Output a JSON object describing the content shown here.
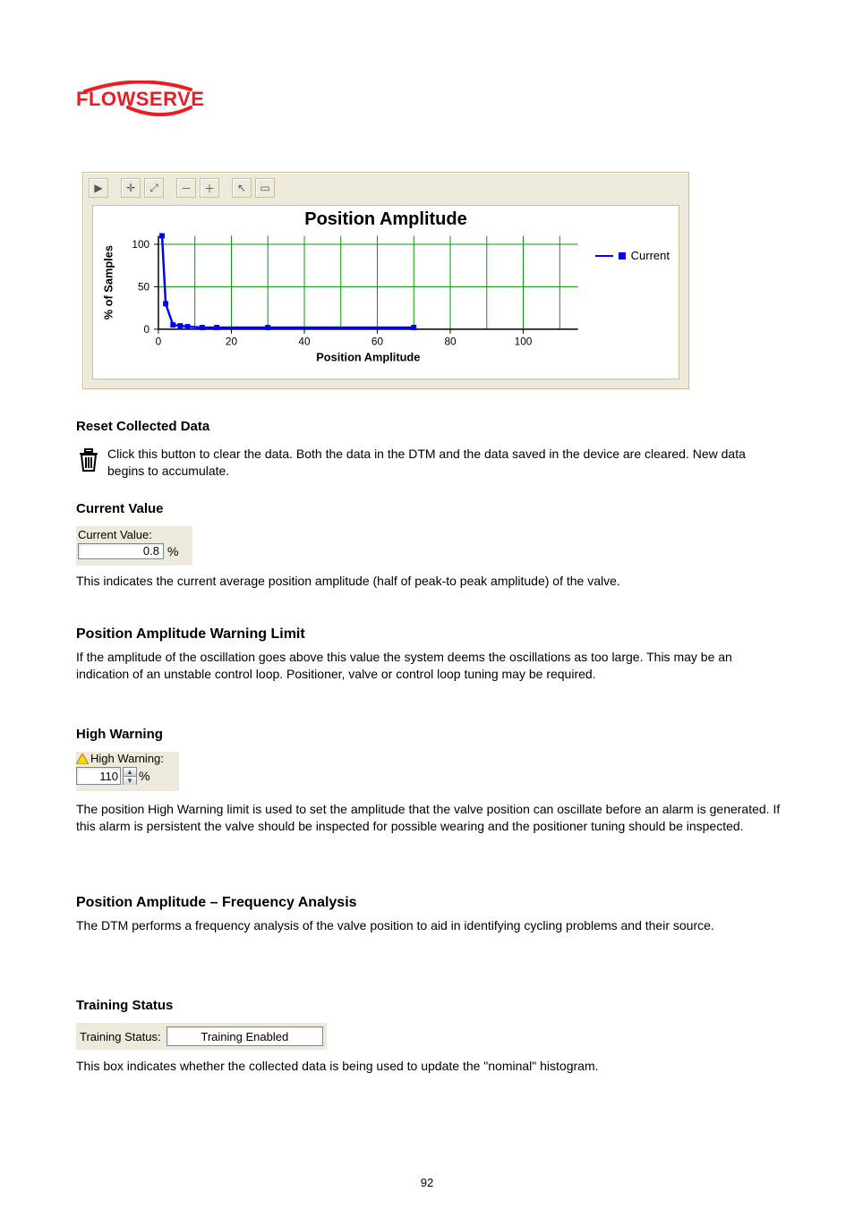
{
  "logo": {
    "text": "FLOWSERVE"
  },
  "chart_data": {
    "type": "line",
    "title": "Position Amplitude",
    "xlabel": "Position Amplitude",
    "ylabel": "% of Samples",
    "xlim": [
      0,
      115
    ],
    "ylim": [
      0,
      110
    ],
    "xticks": [
      0,
      20,
      40,
      60,
      80,
      100
    ],
    "yticks": [
      0,
      50,
      100
    ],
    "series": [
      {
        "name": "Current",
        "x": [
          1,
          2,
          4,
          6,
          8,
          12,
          16,
          30,
          70
        ],
        "values": [
          110,
          30,
          5,
          4,
          3,
          2,
          2,
          2,
          2
        ]
      }
    ]
  },
  "toolbar": {
    "t1": "▶",
    "t2": "✛",
    "t3": "⤢",
    "t4": "－",
    "t5": "＋",
    "t6": "↖",
    "t7": "▭"
  },
  "sections": {
    "reset_title": "Reset Collected Data",
    "reset_body": "Click this button to clear the data. Both the data in the DTM and the data saved in the device are cleared. New data begins to accumulate.",
    "cv_title": "Current Value",
    "cv_body": "This indicates the current average position amplitude (half of peak-to peak amplitude) of the valve.",
    "hw_heading": "Position Amplitude Warning Limit",
    "hw_p1": "If the amplitude of the oscillation goes above this value the system deems the oscillations as too large. This may be an indication of an unstable control loop. Positioner, valve or control loop tuning may be required.",
    "hw_sub": "High Warning",
    "hw_p2": "The position High Warning limit is used to set the amplitude that the valve position can oscillate before an alarm is generated. If this alarm is persistent the valve should be inspected for possible wearing and the positioner tuning should be inspected.",
    "fa_heading": "Position Amplitude – Frequency Analysis",
    "fa_body": "The DTM performs a frequency analysis of the valve position to aid in identifying cycling problems and their source.",
    "ts_title": "Training Status",
    "ts_body": "This box indicates whether the collected data is being used to update the \"nominal\" histogram."
  },
  "widgets": {
    "cv_label": "Current Value:",
    "cv_value": "0.8",
    "cv_unit": "%",
    "hw_label": "High Warning:",
    "hw_value": "110",
    "hw_unit": "%",
    "ts_label": "Training Status:",
    "ts_value": "Training Enabled"
  },
  "legend": {
    "label": "Current"
  },
  "page_number": "92"
}
